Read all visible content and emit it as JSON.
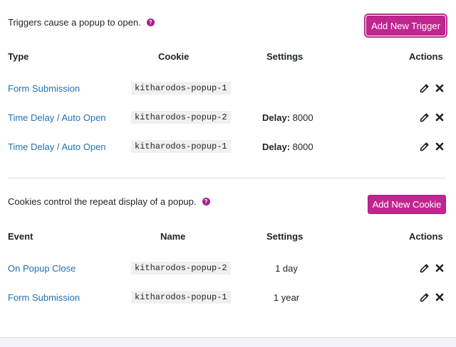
{
  "triggers": {
    "intro": "Triggers cause a popup to open.",
    "add_button": "Add New Trigger",
    "headers": {
      "type": "Type",
      "cookie": "Cookie",
      "settings": "Settings",
      "actions": "Actions"
    },
    "rows": [
      {
        "type": "Form Submission",
        "cookie": "kitharodos-popup-1",
        "settings_label": "",
        "settings_value": ""
      },
      {
        "type": "Time Delay / Auto Open",
        "cookie": "kitharodos-popup-2",
        "settings_label": "Delay:",
        "settings_value": "8000"
      },
      {
        "type": "Time Delay / Auto Open",
        "cookie": "kitharodos-popup-1",
        "settings_label": "Delay:",
        "settings_value": "8000"
      }
    ]
  },
  "cookies": {
    "intro": "Cookies control the repeat display of a popup.",
    "add_button": "Add New Cookie",
    "headers": {
      "event": "Event",
      "name": "Name",
      "settings": "Settings",
      "actions": "Actions"
    },
    "rows": [
      {
        "event": "On Popup Close",
        "name": "kitharodos-popup-2",
        "settings": "1 day"
      },
      {
        "event": "Form Submission",
        "name": "kitharodos-popup-1",
        "settings": "1 year"
      }
    ]
  },
  "help_glyph": "?",
  "colors": {
    "accent": "#c0268f",
    "link": "#2271b1",
    "code_bg": "#f0f0f1"
  },
  "icons": {
    "edit": "pencil-icon",
    "delete": "close-icon",
    "help": "help-icon"
  }
}
